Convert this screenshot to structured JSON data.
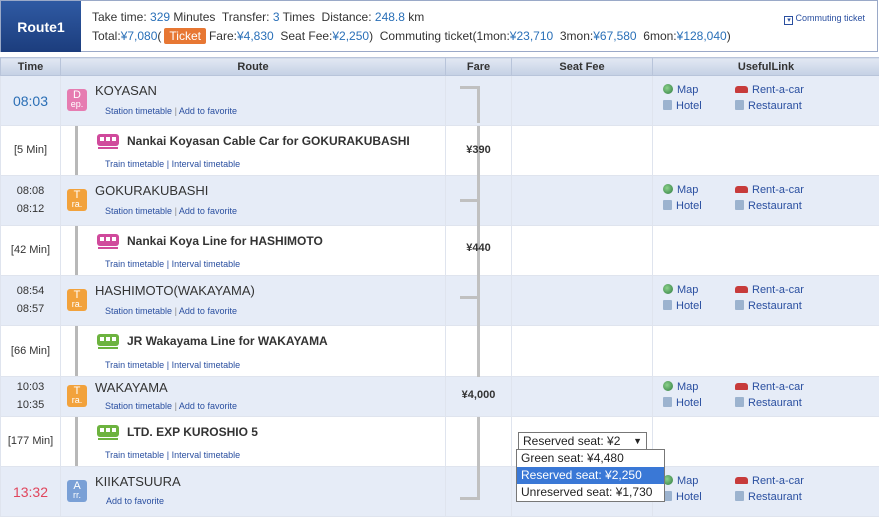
{
  "header": {
    "route_label": "Route1",
    "take_time_label": "Take time:",
    "take_time_value": "329",
    "minutes_label": "Minutes",
    "transfer_label": "Transfer:",
    "transfer_value": "3",
    "times_label": "Times",
    "distance_label": "Distance:",
    "distance_value": "248.8",
    "km_label": "km",
    "total_label": "Total:",
    "total_value": "¥7,080",
    "ticket_button": "Ticket",
    "fare_label": "Fare:",
    "fare_value": "¥4,830",
    "seat_fee_label": "Seat Fee:",
    "seat_fee_value": "¥2,250",
    "commuting_label": "Commuting ticket(1mon:",
    "one_mon_value": "¥23,710",
    "three_mon_label": "3mon:",
    "three_mon_value": "¥67,580",
    "six_mon_label": "6mon:",
    "six_mon_value": "¥128,040",
    "close_paren": ")",
    "commuting_link": "Commuting ticket"
  },
  "columns": {
    "time": "Time",
    "route": "Route",
    "fare": "Fare",
    "seat_fee": "Seat Fee",
    "useful_link": "UsefulLink"
  },
  "station_links": {
    "timetable": "Station timetable",
    "favorite": "Add to favorite",
    "sep": "|"
  },
  "train_links": {
    "train_timetable": "Train timetable",
    "interval_timetable": "Interval timetable",
    "sep": "|"
  },
  "useful": {
    "map": "Map",
    "rent": "Rent-a-car",
    "hotel": "Hotel",
    "restaurant": "Restaurant"
  },
  "stations": [
    {
      "name": "KOYASAN",
      "time1": "08:03",
      "time2": "",
      "badge_top": "D",
      "badge_bottom": "ep."
    },
    {
      "name": "GOKURAKUBASHI",
      "time1": "08:08",
      "time2": "08:12",
      "badge_top": "T",
      "badge_bottom": "ra."
    },
    {
      "name": "HASHIMOTO(WAKAYAMA)",
      "time1": "08:54",
      "time2": "08:57",
      "badge_top": "T",
      "badge_bottom": "ra."
    },
    {
      "name": "WAKAYAMA",
      "time1": "10:03",
      "time2": "10:35",
      "badge_top": "T",
      "badge_bottom": "ra."
    },
    {
      "name": "KIIKATSUURA",
      "time1": "13:32",
      "time2": "",
      "badge_top": "A",
      "badge_bottom": "rr."
    }
  ],
  "segments": [
    {
      "duration": "[5 Min]",
      "name": "Nankai Koyasan Cable Car  for GOKURAKUBASHI",
      "fare": "¥390",
      "color": "#d04a9c"
    },
    {
      "duration": "[42 Min]",
      "name": "Nankai Koya Line  for HASHIMOTO",
      "fare": "¥440",
      "color": "#d04a9c"
    },
    {
      "duration": "[66 Min]",
      "name": "JR Wakayama Line  for WAKAYAMA",
      "fare": "",
      "color": "#6db33f"
    },
    {
      "duration": "[177 Min]",
      "name": "LTD. EXP KUROSHIO 5",
      "fare": "",
      "color": "#6db33f"
    }
  ],
  "wakayama_fare": "¥4,000",
  "seat_select": {
    "current": "Reserved seat: ¥2",
    "options": [
      "Green seat: ¥4,480",
      "Reserved seat: ¥2,250",
      "Unreserved seat: ¥1,730"
    ],
    "selected_index": 1
  }
}
